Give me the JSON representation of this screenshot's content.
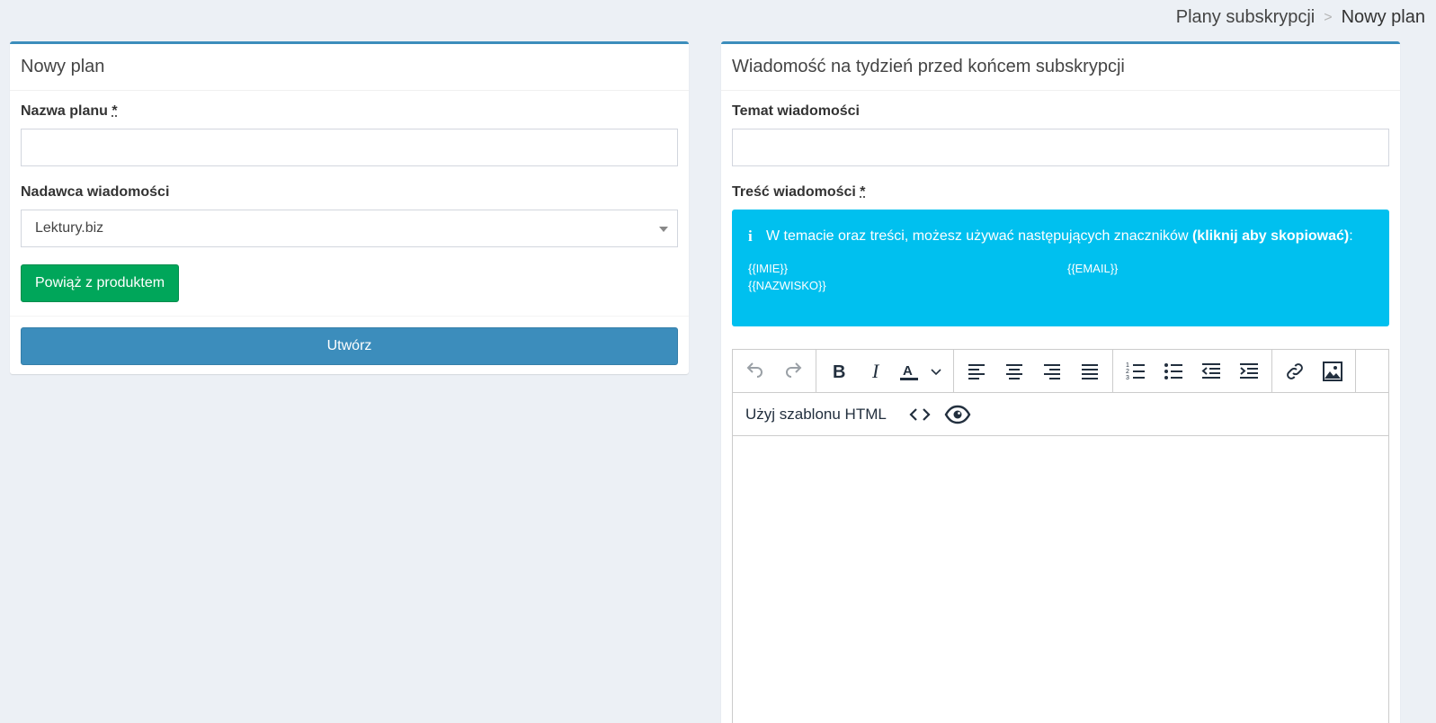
{
  "breadcrumb": {
    "parent": "Plany subskrypcji",
    "separator": ">",
    "current": "Nowy plan"
  },
  "left_box": {
    "title": "Nowy plan",
    "plan_name_label": "Nazwa planu",
    "plan_name_value": "",
    "sender_label": "Nadawca wiadomości",
    "sender_selected": "Lektury.biz",
    "link_product_button": "Powiąż z produktem",
    "create_button": "Utwórz"
  },
  "right_box": {
    "title": "Wiadomość na tydzień przed końcem subskrypcji",
    "subject_label": "Temat wiadomości",
    "subject_value": "",
    "content_label": "Treść wiadomości",
    "required_marker": "*",
    "info": {
      "text": "W temacie oraz treści, możesz używać następujących znaczników",
      "bold_text": "(kliknij aby skopiować)",
      "colon": ":",
      "icon": "info-icon",
      "tags": [
        "{{IMIE}}",
        "{{EMAIL}}",
        "{{NAZWISKO}}"
      ]
    },
    "editor": {
      "template_label": "Użyj szablonu HTML",
      "tools": [
        "undo-icon",
        "redo-icon",
        "bold-icon",
        "italic-icon",
        "text-color-icon",
        "chevron-down-icon",
        "align-left-icon",
        "align-center-icon",
        "align-right-icon",
        "align-justify-icon",
        "numbered-list-icon",
        "bullet-list-icon",
        "outdent-icon",
        "indent-icon",
        "link-icon",
        "image-icon",
        "code-icon",
        "eye-icon"
      ]
    }
  },
  "colors": {
    "background": "#ecf0f5",
    "box_border_top": "#3c8dbc",
    "success": "#00a65a",
    "primary": "#3c8dbc",
    "info": "#00c0ef"
  }
}
